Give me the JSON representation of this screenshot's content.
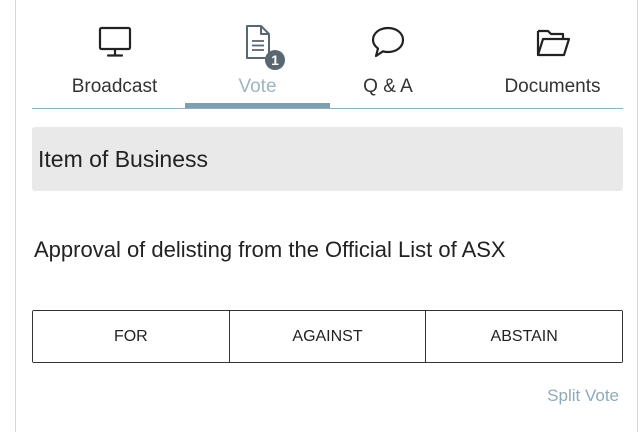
{
  "tabs": [
    {
      "label": "Broadcast",
      "icon": "monitor-icon",
      "active": false
    },
    {
      "label": "Vote",
      "icon": "document-icon",
      "active": true,
      "badge": "1"
    },
    {
      "label": "Q & A",
      "icon": "chat-bubble-icon",
      "active": false
    },
    {
      "label": "Documents",
      "icon": "folder-icon",
      "active": false
    }
  ],
  "section": {
    "title": "Item of Business"
  },
  "resolution": {
    "text": "Approval of delisting from the Official List of ASX"
  },
  "vote_options": [
    "FOR",
    "AGAINST",
    "ABSTAIN"
  ],
  "split_vote_label": "Split Vote",
  "colors": {
    "accent": "#7e9fb0",
    "active_tab_text": "#9eb5c2",
    "link": "#8eaabb",
    "header_bg": "#e9e9e9",
    "badge_bg": "#5b6770"
  }
}
